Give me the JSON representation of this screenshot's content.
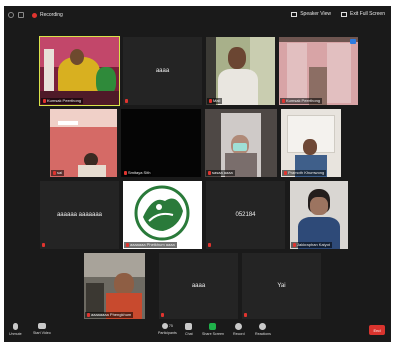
{
  "topbar": {
    "recording_label": "Recording",
    "speaker_view_label": "Speaker View",
    "exit_fullscreen_label": "Exit Full Screen"
  },
  "tiles": {
    "t1": {
      "name": "Kumsak Peerthong"
    },
    "t2": {
      "display": "aaaa"
    },
    "t3": {
      "name": "Mali"
    },
    "t4": {
      "name": "Kumsak Peerthong"
    },
    "t5": {
      "name": "sai"
    },
    "t6": {
      "name": "Smitaya Sith"
    },
    "t7": {
      "name": "sasaa aaaa"
    },
    "t8": {
      "name": "Pramoth Khumwong"
    },
    "t9": {
      "display": "aaaaaa aaaaaaa"
    },
    "t10": {
      "name": "aaaaaaa Phetkhum aaaa"
    },
    "t11": {
      "display": "052184"
    },
    "t12": {
      "name": "Jakkraphan Kaiyot"
    },
    "t13": {
      "name": "aaaaaaaa Phengkhum"
    },
    "t14": {
      "display": "aaaa"
    },
    "t15": {
      "display": "Yai"
    }
  },
  "bottombar": {
    "unmute_label": "Unmute",
    "start_video_label": "Start Video",
    "participants_label": "Participants",
    "participants_count": "75",
    "chat_label": "Chat",
    "share_screen_label": "Share Screen",
    "record_label": "Record",
    "reactions_label": "Reactions",
    "end_label": "End"
  },
  "colors": {
    "background": "#1a1a1a",
    "tile": "#242424",
    "active_speaker_border": "#d9e34a",
    "mute_red": "#e0342f",
    "share_green": "#1fb14a",
    "end_red": "#d9342e"
  }
}
